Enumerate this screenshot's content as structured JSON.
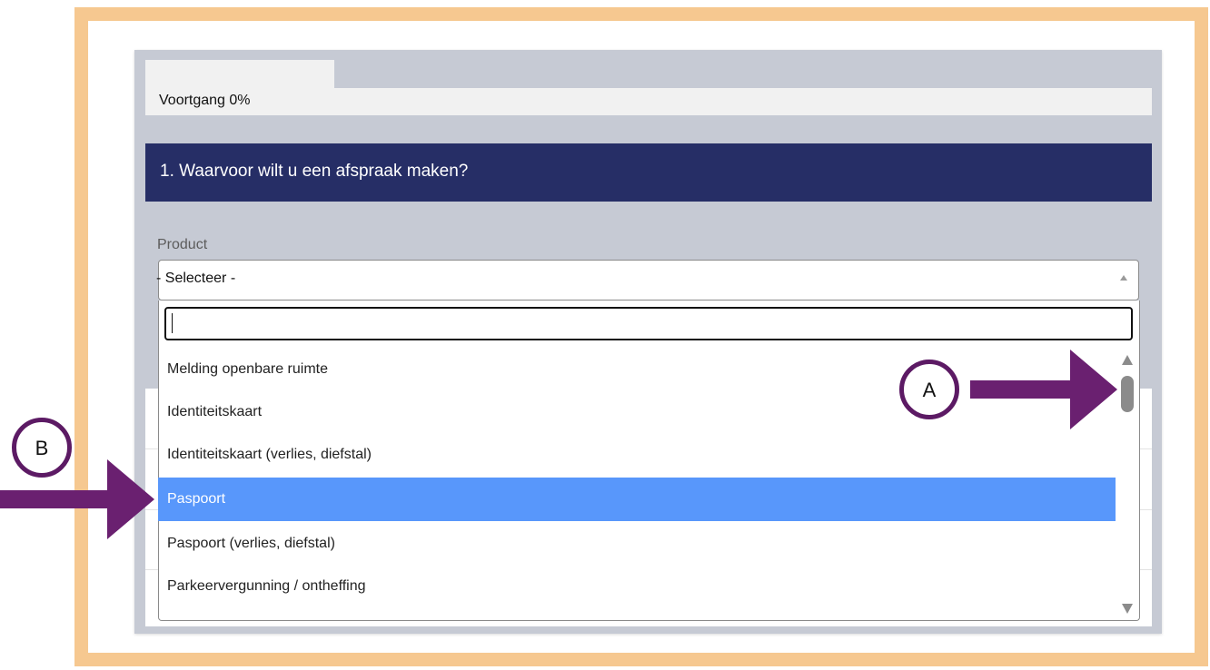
{
  "progress": {
    "label": "Voortgang 0%",
    "value": 0
  },
  "question": {
    "title": "1. Waarvoor wilt u een afspraak maken?"
  },
  "product": {
    "label": "Product",
    "selected_display": "- Selecteer -",
    "search_value": ""
  },
  "options": [
    {
      "label": "Melding openbare ruimte",
      "highlighted": false
    },
    {
      "label": "Identiteitskaart",
      "highlighted": false
    },
    {
      "label": "Identiteitskaart (verlies, diefstal)",
      "highlighted": false
    },
    {
      "label": "Paspoort",
      "highlighted": true
    },
    {
      "label": "Paspoort (verlies, diefstal)",
      "highlighted": false
    },
    {
      "label": "Parkeervergunning / ontheffing",
      "highlighted": false
    }
  ],
  "annotations": {
    "marker_a": "A",
    "marker_b": "B"
  },
  "colors": {
    "frame_border": "#f6c890",
    "panel_bg": "#c6cad4",
    "header_bg": "#262e66",
    "highlight_bg": "#5897fb",
    "annotation_purple": "#6a2070"
  },
  "icons": {
    "select_arrow": "caret-up-icon",
    "scroll_up": "scroll-up-icon",
    "scroll_down": "scroll-down-icon"
  }
}
